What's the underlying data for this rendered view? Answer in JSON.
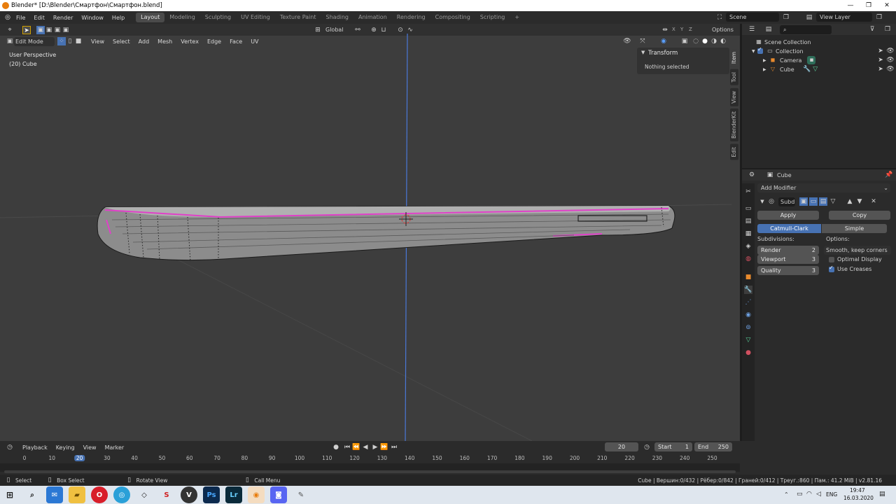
{
  "window": {
    "title": "Blender* [D:\\Blender\\Смартфон\\Смартфон.blend]",
    "controls": [
      "—",
      "❐",
      "✕"
    ]
  },
  "menubar": {
    "menus": [
      "File",
      "Edit",
      "Render",
      "Window",
      "Help"
    ],
    "workspaces": [
      "Layout",
      "Modeling",
      "Sculpting",
      "UV Editing",
      "Texture Paint",
      "Shading",
      "Animation",
      "Rendering",
      "Compositing",
      "Scripting"
    ],
    "active_workspace": "Layout",
    "add_tab": "+",
    "scene": "Scene",
    "view_layer": "View Layer"
  },
  "viewport": {
    "transform_orientation": "Global",
    "options_label": "Options",
    "axes": [
      "X",
      "Y",
      "Z"
    ],
    "mode": "Edit Mode",
    "header_menus": [
      "View",
      "Select",
      "Add",
      "Mesh",
      "Vertex",
      "Edge",
      "Face",
      "UV"
    ],
    "perspective": "User Perspective",
    "object_info": "(20) Cube",
    "npanel": {
      "header": "Transform",
      "message": "Nothing selected",
      "tabs": [
        "Item",
        "Tool",
        "View",
        "BlenderKit",
        "Edit"
      ]
    }
  },
  "outliner": {
    "search_placeholder": "",
    "root": "Scene Collection",
    "collection": "Collection",
    "items": [
      {
        "name": "Camera",
        "icon": "camera-icon"
      },
      {
        "name": "Cube",
        "icon": "mesh-icon"
      }
    ]
  },
  "properties": {
    "object_name": "Cube",
    "add_modifier": "Add Modifier",
    "modifier_name": "Subd",
    "apply_label": "Apply",
    "copy_label": "Copy",
    "types": [
      "Catmull-Clark",
      "Simple"
    ],
    "active_type": "Catmull-Clark",
    "subdivisions_label": "Subdivisions:",
    "options_label": "Options:",
    "render_label": "Render",
    "render_value": "2",
    "viewport_label": "Viewport",
    "viewport_value": "3",
    "quality_label": "Quality",
    "quality_value": "3",
    "uv_smooth": "Smooth, keep corners",
    "optimal_display_label": "Optimal Display",
    "optimal_display": false,
    "use_creases_label": "Use Creases",
    "use_creases": true
  },
  "timeline": {
    "menus": [
      "Playback",
      "Keying",
      "View",
      "Marker"
    ],
    "current_frame": "20",
    "start_label": "Start",
    "start_value": "1",
    "end_label": "End",
    "end_value": "250",
    "ticks": [
      "0",
      "10",
      "20",
      "30",
      "40",
      "50",
      "60",
      "70",
      "80",
      "90",
      "100",
      "110",
      "120",
      "130",
      "140",
      "150",
      "160",
      "170",
      "180",
      "190",
      "200",
      "210",
      "220",
      "230",
      "240",
      "250"
    ],
    "active_tick": "20"
  },
  "statusbar": {
    "select": "Select",
    "box_select": "Box Select",
    "rotate_view": "Rotate View",
    "call_menu": "Call Menu",
    "stats": "Cube | Вершин:0/432 | Рёбер:0/842 | Граней:0/412 | Треуг.:860 | Пам.: 41.2 MiB | v2.81.16"
  },
  "taskbar": {
    "language": "ENG",
    "time": "19:47",
    "date": "16.03.2020"
  },
  "colors": {
    "accent": "#4772b3",
    "active_frame": "#4772b3",
    "edit_edge": "#e040c8",
    "y_axis": "#4a78d8"
  }
}
